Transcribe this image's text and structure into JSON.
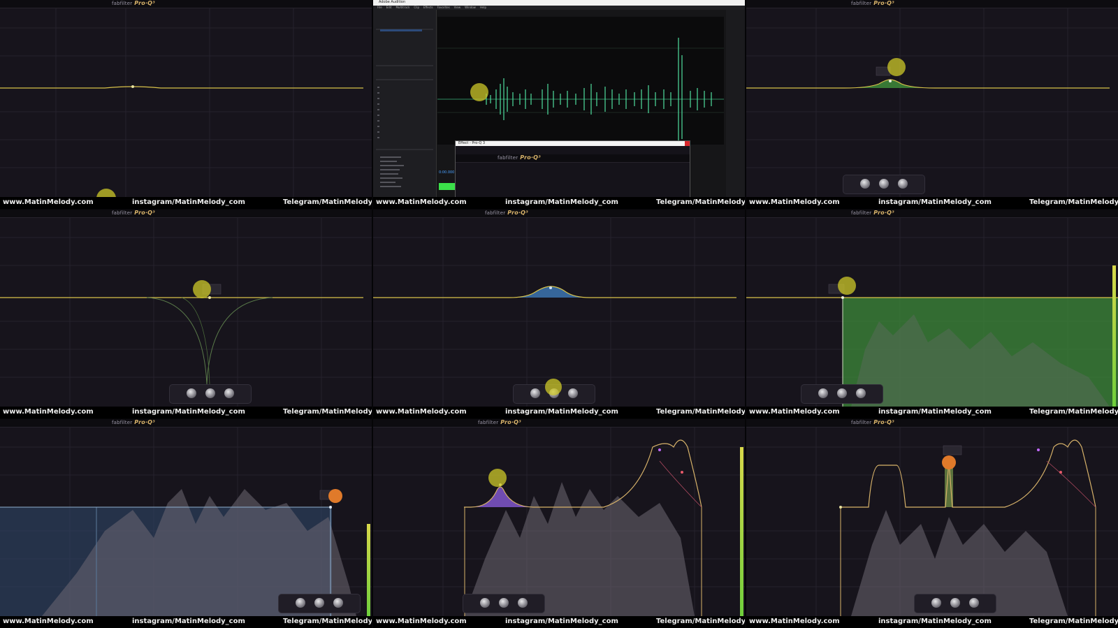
{
  "plugin": {
    "brand": "fabfilter",
    "product": "Pro·Q³"
  },
  "watermarks": {
    "site": "www.MatinMelody.com",
    "instagram": "instagram/MatinMelody_com",
    "telegram": "Telegram/MatinMelody"
  },
  "audition": {
    "window_title": "Adobe Audition",
    "menu": [
      "File",
      "Edit",
      "Multitrack",
      "Clip",
      "Effects",
      "Favorites",
      "View",
      "Window",
      "Help"
    ],
    "effect_dialog_title": "Effect - Pro-Q 3",
    "timecode": "0:00.000"
  },
  "colors": {
    "background": "#17141c",
    "flat_curve": "#d8c24a",
    "highlight": "#cdc828",
    "band_blue": "#3a6fa8",
    "band_green": "#3e8a3a",
    "band_purple": "#7a52c2",
    "band_orange": "#e07a2a",
    "waveform": "#4fe0a0",
    "spectrum": "#6e6873"
  }
}
